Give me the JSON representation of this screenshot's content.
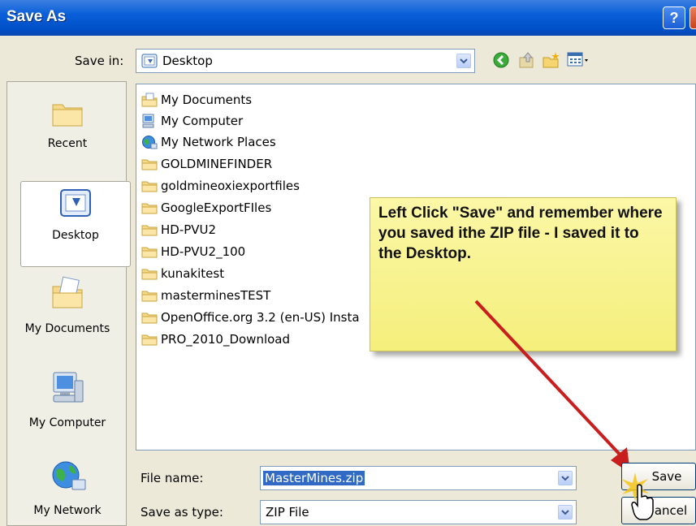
{
  "window": {
    "title": "Save As",
    "help_label": "?"
  },
  "toolbar": {
    "save_in_label": "Save in:",
    "save_in_value": "Desktop",
    "icons": [
      "back-icon",
      "up-folder-icon",
      "new-folder-icon",
      "views-menu-icon"
    ]
  },
  "sidebar": {
    "items": [
      {
        "label": "Recent",
        "icon": "recent-folder-icon"
      },
      {
        "label": "Desktop",
        "icon": "desktop-icon"
      },
      {
        "label": "My Documents",
        "icon": "my-documents-icon"
      },
      {
        "label": "My Computer",
        "icon": "my-computer-icon"
      },
      {
        "label": "My Network",
        "icon": "my-network-icon"
      }
    ]
  },
  "files": [
    {
      "name": "My Documents",
      "icon": "my-documents-icon"
    },
    {
      "name": "My Computer",
      "icon": "my-computer-icon"
    },
    {
      "name": "My Network Places",
      "icon": "network-icon"
    },
    {
      "name": "GOLDMINEFINDER",
      "icon": "folder-icon"
    },
    {
      "name": "goldmineoxiexportfiles",
      "icon": "folder-icon"
    },
    {
      "name": "GoogleExportFIles",
      "icon": "folder-icon"
    },
    {
      "name": "HD-PVU2",
      "icon": "folder-icon"
    },
    {
      "name": "HD-PVU2_100",
      "icon": "folder-icon"
    },
    {
      "name": "kunakitest",
      "icon": "folder-icon"
    },
    {
      "name": "masterminesTEST",
      "icon": "folder-icon"
    },
    {
      "name": "OpenOffice.org 3.2 (en-US) Insta",
      "icon": "folder-icon"
    },
    {
      "name": "PRO_2010_Download",
      "icon": "folder-icon"
    }
  ],
  "callout": {
    "text": "Left Click \"Save\" and remember where you saved ithe ZIP file - I saved it to the Desktop."
  },
  "form": {
    "file_name_label": "File name:",
    "file_name_value": "MasterMines.zip",
    "save_type_label": "Save as type:",
    "save_type_value": "ZIP File",
    "save_button": "Save",
    "cancel_button": "ancel"
  },
  "colors": {
    "title_bar": "#0a5fd8",
    "callout_bg": "#f7f28a",
    "arrow": "#c81e1e",
    "selection": "#316ac5"
  }
}
